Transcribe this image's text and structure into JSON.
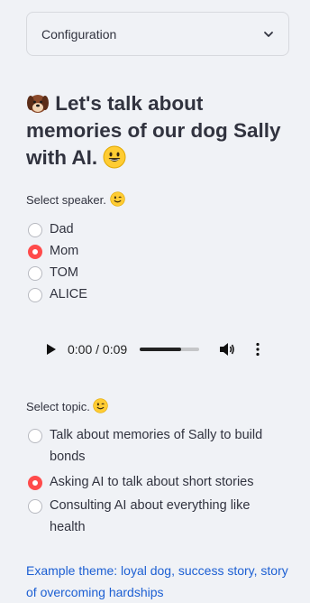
{
  "config": {
    "label": "Configuration"
  },
  "title": {
    "text": "Let's talk about memories of our dog Sally with AI."
  },
  "speaker": {
    "label": "Select speaker.",
    "options": [
      "Dad",
      "Mom",
      "TOM",
      "ALICE"
    ],
    "selected": "Mom"
  },
  "audio": {
    "time": "0:00 / 0:09",
    "progress": 0.7
  },
  "topic": {
    "label": "Select topic.",
    "options": [
      "Talk about memories of Sally to build bonds",
      "Asking AI to talk about short stories",
      "Consulting AI about everything like health"
    ],
    "selected": "Asking AI to talk about short stories"
  },
  "example": {
    "text": "Example theme: loyal dog, success story, story of overcoming hardships"
  },
  "icons": {
    "dog": "dog-face-icon",
    "grin": "grinning-face-icon",
    "wink": "winking-face-icon",
    "chevron": "chevron-down-icon",
    "play": "play-icon",
    "volume": "volume-icon",
    "more": "more-vert-icon"
  },
  "colors": {
    "accent": "#ff4b4b",
    "link": "#1c5fd3",
    "background": "#f0f2f6"
  }
}
